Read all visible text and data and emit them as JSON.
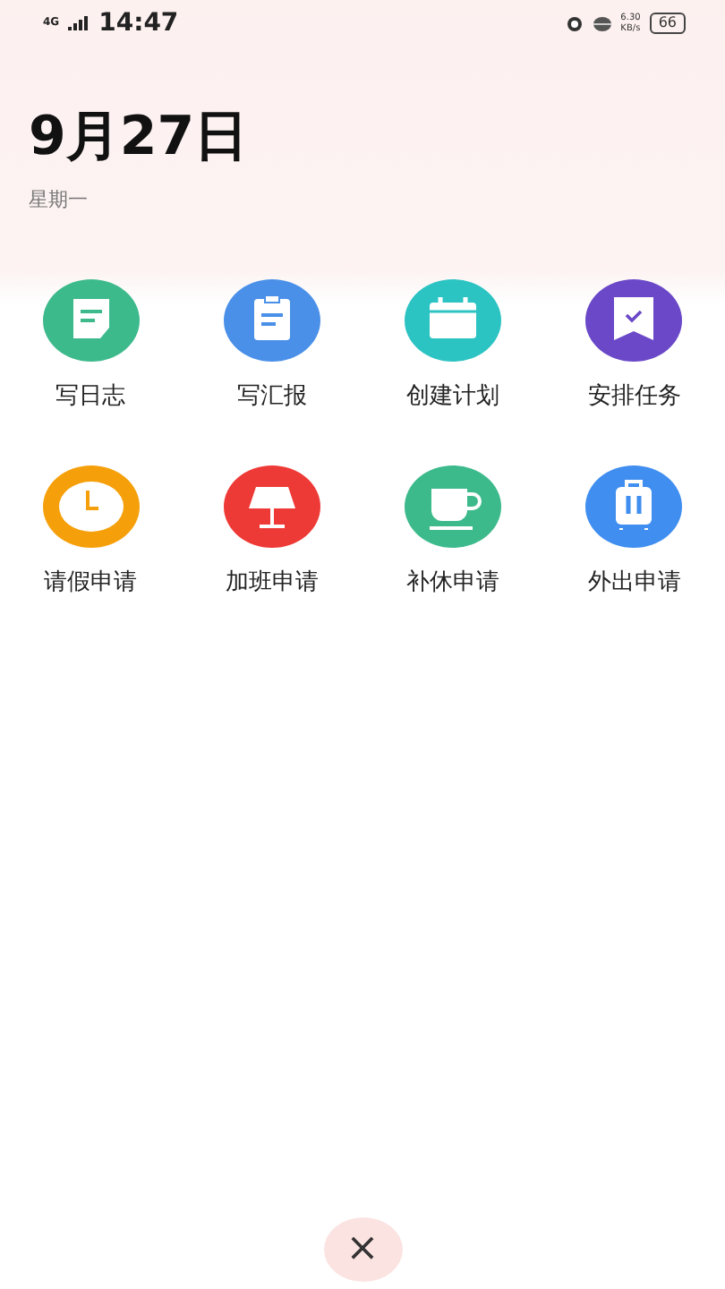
{
  "status_bar": {
    "network": "4G",
    "time": "14:47",
    "speed_value": "6.30",
    "speed_unit": "KB/s",
    "battery": "66"
  },
  "header": {
    "date": "9月27日",
    "weekday": "星期一"
  },
  "actions": [
    {
      "label": "写日志",
      "kind": "note",
      "color": "#3dba8c"
    },
    {
      "label": "写汇报",
      "kind": "report",
      "color": "#4a90e8"
    },
    {
      "label": "创建计划",
      "kind": "calendar",
      "color": "#2cc3c3"
    },
    {
      "label": "安排任务",
      "kind": "task",
      "color": "#6a48c8"
    },
    {
      "label": "请假申请",
      "kind": "clock",
      "color": "#f5a00a"
    },
    {
      "label": "加班申请",
      "kind": "lamp",
      "color": "#ee3a36"
    },
    {
      "label": "补休申请",
      "kind": "cup",
      "color": "#3dba8c"
    },
    {
      "label": "外出申请",
      "kind": "suitcase",
      "color": "#3f8ef0"
    }
  ],
  "close_button": {
    "label": "×"
  }
}
